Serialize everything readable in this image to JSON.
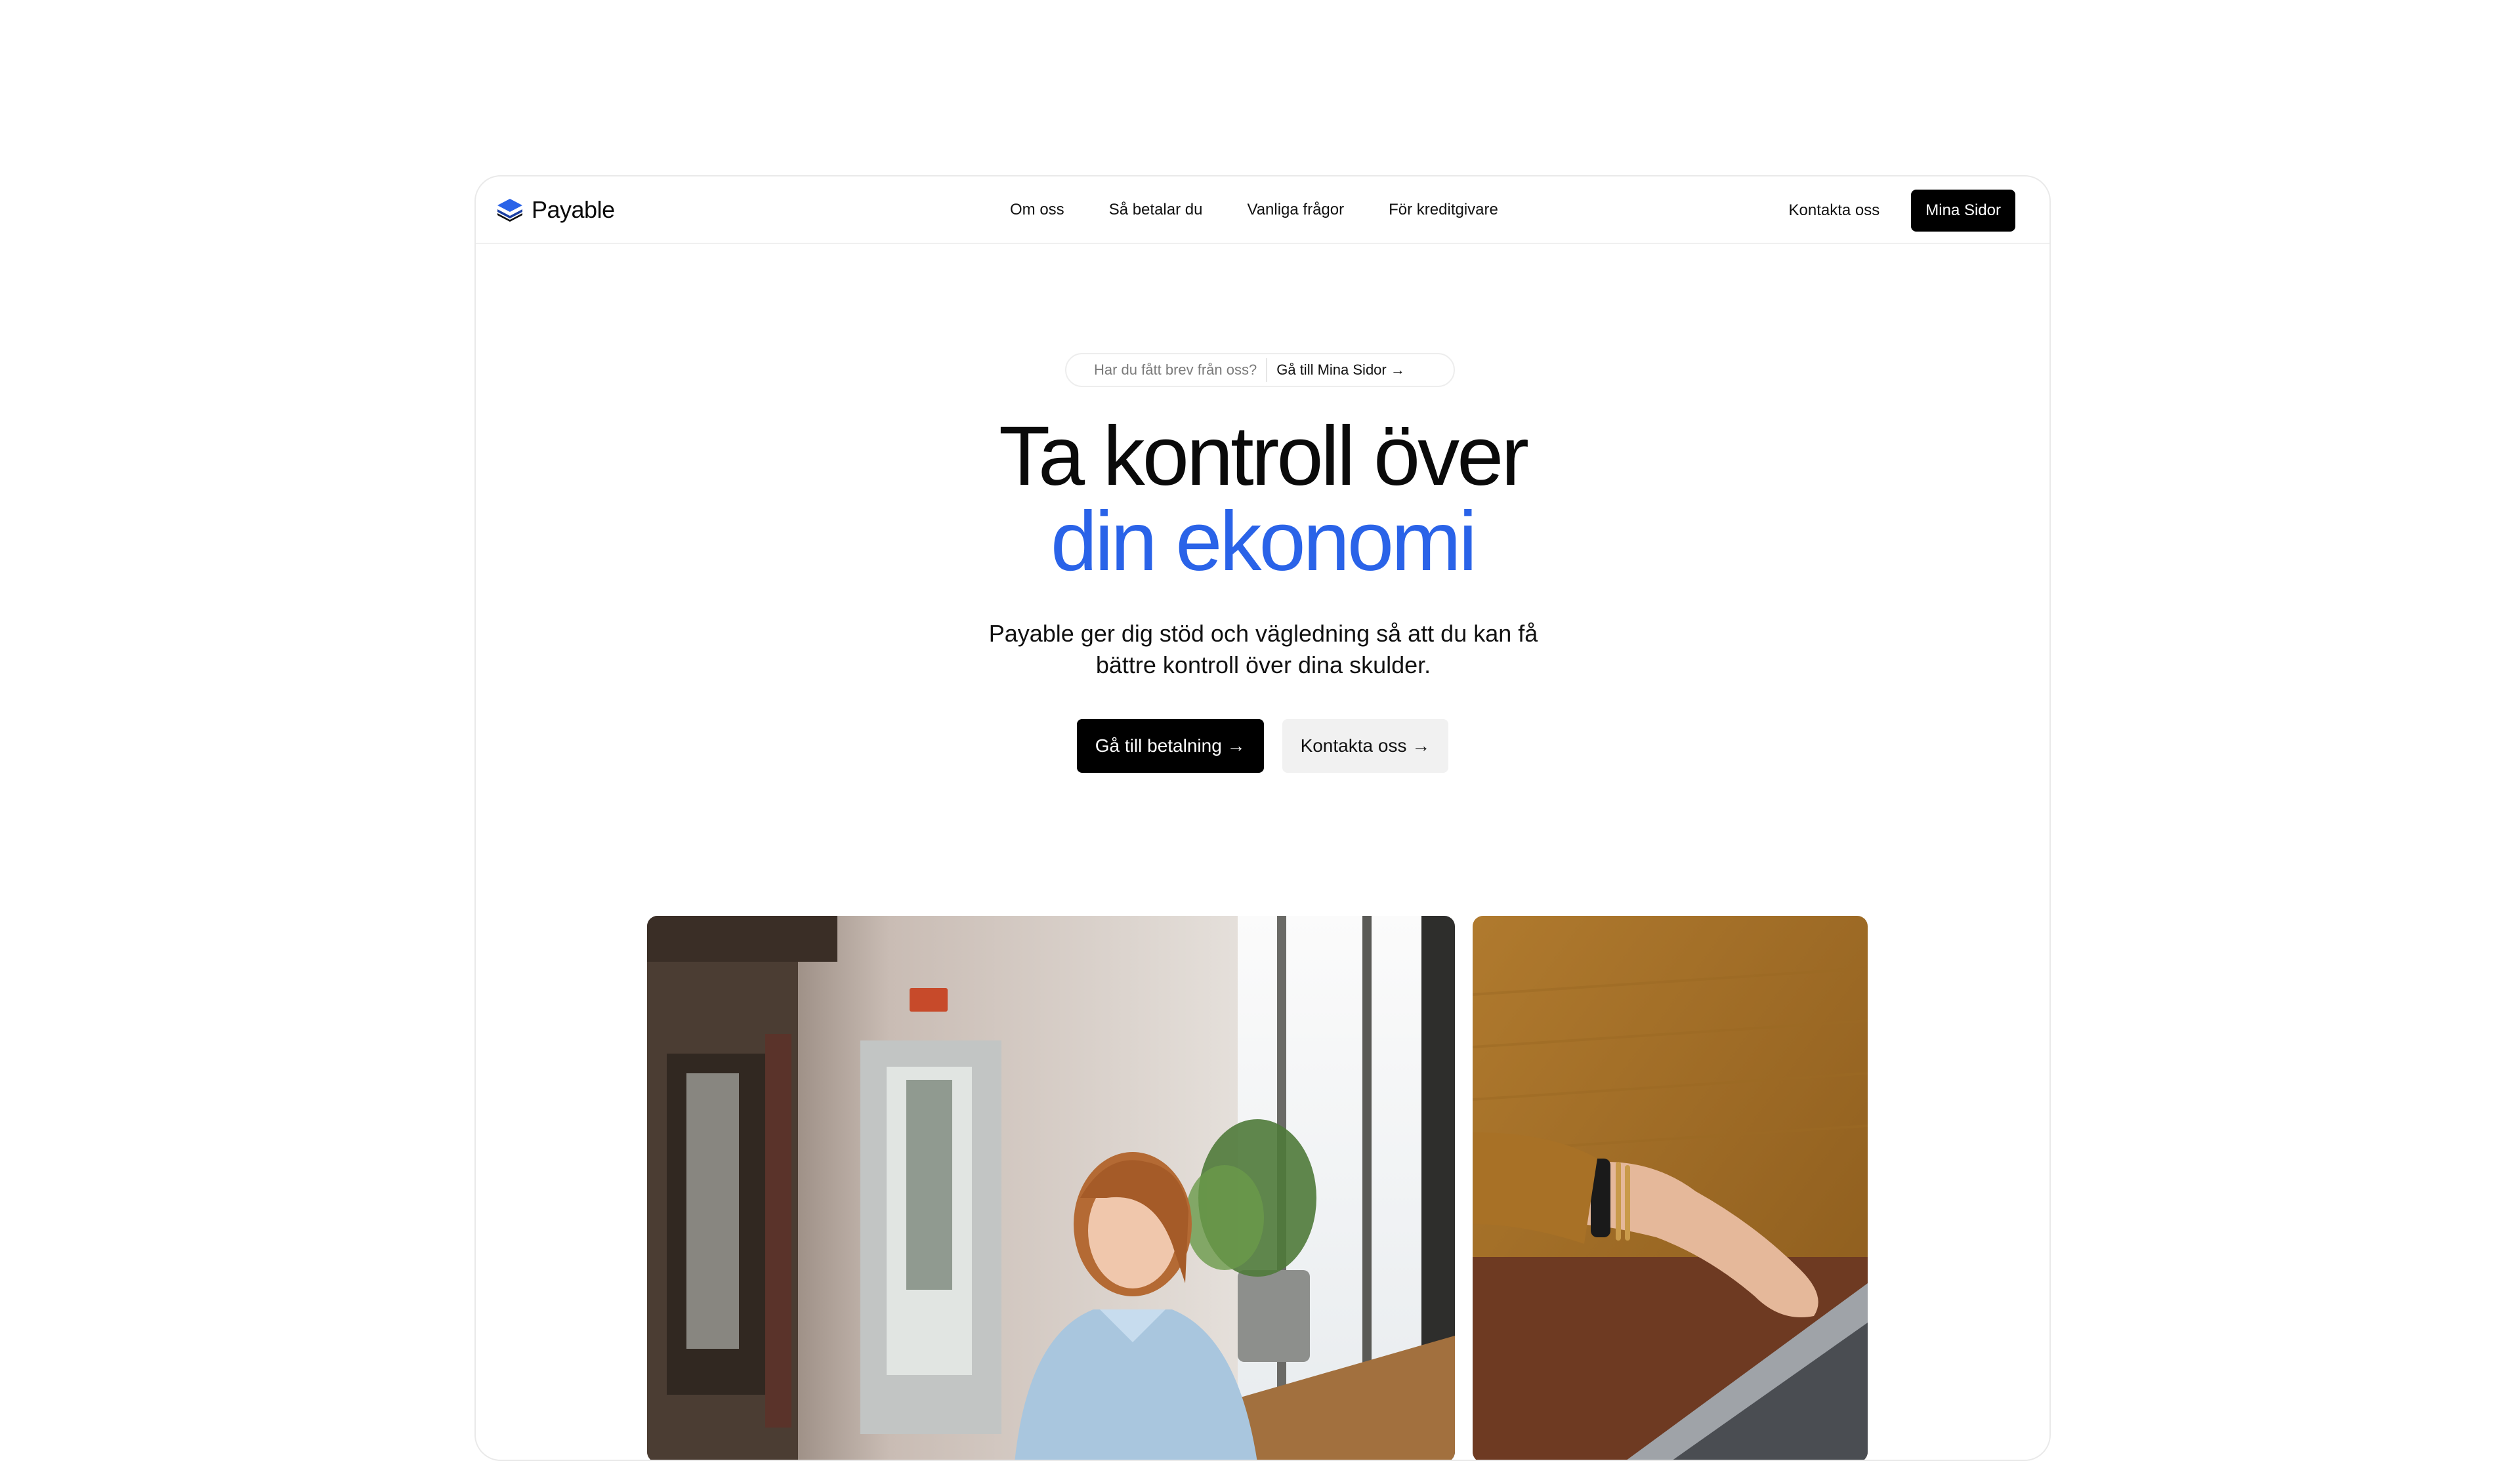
{
  "brand": {
    "name": "Payable",
    "logo_icon": "layers-icon",
    "logo_color": "#2a63e8"
  },
  "nav": {
    "links": [
      {
        "label": "Om oss"
      },
      {
        "label": "Så betalar du"
      },
      {
        "label": "Vanliga frågor"
      },
      {
        "label": "För kreditgivare"
      }
    ],
    "contact_label": "Kontakta oss",
    "cta_label": "Mina Sidor"
  },
  "announcement": {
    "question": "Har du fått brev från oss?",
    "link_label": "Gå till Mina Sidor →"
  },
  "hero": {
    "title_line1": "Ta kontroll över",
    "title_line2": "din ekonomi",
    "subtitle": "Payable ger dig stöd och vägledning så att du kan få bättre kontroll över dina skulder.",
    "primary_label": "Gå till betalning →",
    "secondary_label": "Kontakta oss →"
  },
  "colors": {
    "accent": "#2a63e8",
    "primary_button": "#000000",
    "secondary_button": "#f1f1f1"
  },
  "images": [
    {
      "name": "smiling-woman-cafe-photo"
    },
    {
      "name": "hands-on-laptop-photo"
    }
  ]
}
